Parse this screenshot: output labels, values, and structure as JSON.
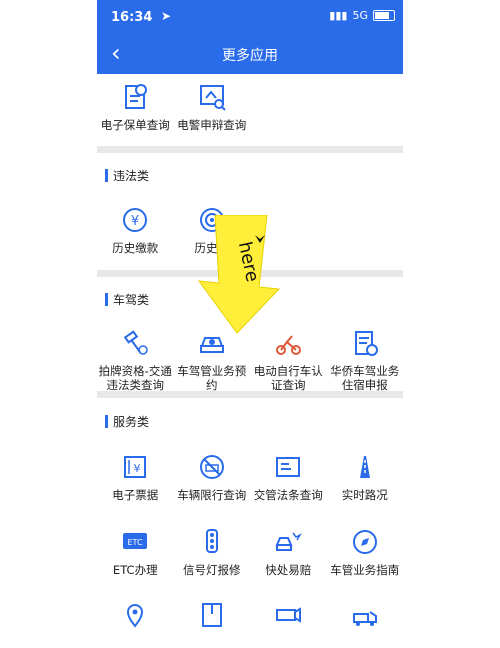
{
  "status": {
    "time": "16:34",
    "signal": "5G"
  },
  "nav": {
    "title": "更多应用"
  },
  "top_items": [
    {
      "label": "电子保单查询",
      "icon": "insurance-doc-icon"
    },
    {
      "label": "电警申辩查询",
      "icon": "camera-appeal-icon"
    }
  ],
  "sections": {
    "violation": {
      "title": "违法类",
      "items": [
        {
          "label": "历史缴款",
          "icon": "yuan-coin-icon"
        },
        {
          "label": "历史举",
          "icon": "target-report-icon"
        }
      ]
    },
    "vehicle": {
      "title": "车驾类",
      "items": [
        {
          "label": "拍牌资格-交通违法类查询",
          "icon": "gavel-icon"
        },
        {
          "label": "车驾管业务预约",
          "icon": "car-appointment-icon"
        },
        {
          "label": "电动自行车认证查询",
          "icon": "ebike-icon"
        },
        {
          "label": "华侨车驾业务住宿申报",
          "icon": "residence-form-icon"
        }
      ]
    },
    "service": {
      "title": "服务类",
      "rows": [
        [
          {
            "label": "电子票据",
            "icon": "receipt-icon"
          },
          {
            "label": "车辆限行查询",
            "icon": "no-car-icon"
          },
          {
            "label": "交管法条查询",
            "icon": "law-doc-icon"
          },
          {
            "label": "实时路况",
            "icon": "road-traffic-icon"
          }
        ],
        [
          {
            "label": "ETC办理",
            "icon": "etc-card-icon"
          },
          {
            "label": "信号灯报修",
            "icon": "traffic-light-icon"
          },
          {
            "label": "快处易赔",
            "icon": "car-crash-icon"
          },
          {
            "label": "车管业务指南",
            "icon": "compass-icon"
          }
        ],
        [
          {
            "label": "",
            "icon": "map-pin-icon"
          },
          {
            "label": "",
            "icon": "guide-book-icon"
          },
          {
            "label": "",
            "icon": "camera-icon"
          },
          {
            "label": "",
            "icon": "tow-truck-icon"
          }
        ]
      ]
    }
  },
  "overlay": {
    "text": "here",
    "color": "#ffef3a"
  },
  "colors": {
    "brand": "#2a6bea",
    "icon": "#2a6bea"
  }
}
